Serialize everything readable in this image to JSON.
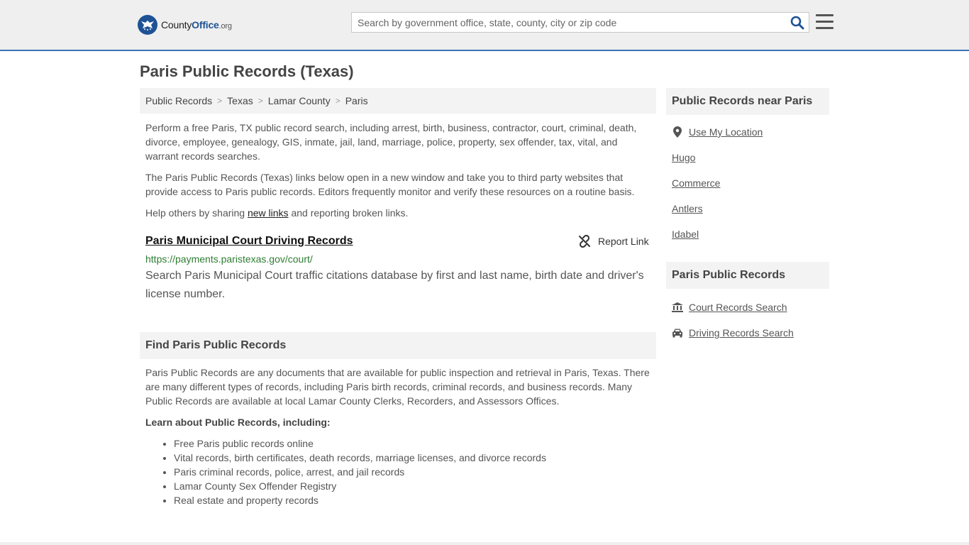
{
  "header": {
    "logo_text_main": "County",
    "logo_text_office": "Office",
    "logo_text_org": ".org",
    "search_placeholder": "Search by government office, state, county, city or zip code"
  },
  "page": {
    "title": "Paris Public Records (Texas)"
  },
  "breadcrumb": [
    "Public Records",
    "Texas",
    "Lamar County",
    "Paris"
  ],
  "intro": {
    "p1": "Perform a free Paris, TX public record search, including arrest, birth, business, contractor, court, criminal, death, divorce, employee, genealogy, GIS, inmate, jail, land, marriage, police, property, sex offender, tax, vital, and warrant records searches.",
    "p2": "The Paris Public Records (Texas) links below open in a new window and take you to third party websites that provide access to Paris public records. Editors frequently monitor and verify these resources on a routine basis.",
    "p3_before": "Help others by sharing ",
    "p3_link": "new links",
    "p3_after": " and reporting broken links."
  },
  "result": {
    "title": "Paris Municipal Court Driving Records",
    "report_label": "Report Link",
    "url": "https://payments.paristexas.gov/court/",
    "description": "Search Paris Municipal Court traffic citations database by first and last name, birth date and driver's license number."
  },
  "find": {
    "heading": "Find Paris Public Records",
    "text": "Paris Public Records are any documents that are available for public inspection and retrieval in Paris, Texas. There are many different types of records, including Paris birth records, criminal records, and business records. Many Public Records are available at local Lamar County Clerks, Recorders, and Assessors Offices.",
    "learn_heading": "Learn about Public Records, including:",
    "learn_items": [
      "Free Paris public records online",
      "Vital records, birth certificates, death records, marriage licenses, and divorce records",
      "Paris criminal records, police, arrest, and jail records",
      "Lamar County Sex Offender Registry",
      "Real estate and property records"
    ]
  },
  "sidebar": {
    "near_heading": "Public Records near Paris",
    "use_location": "Use My Location",
    "near_links": [
      "Hugo",
      "Commerce",
      "Antlers",
      "Idabel"
    ],
    "records_heading": "Paris Public Records",
    "record_links": [
      "Court Records Search",
      "Driving Records Search"
    ]
  }
}
